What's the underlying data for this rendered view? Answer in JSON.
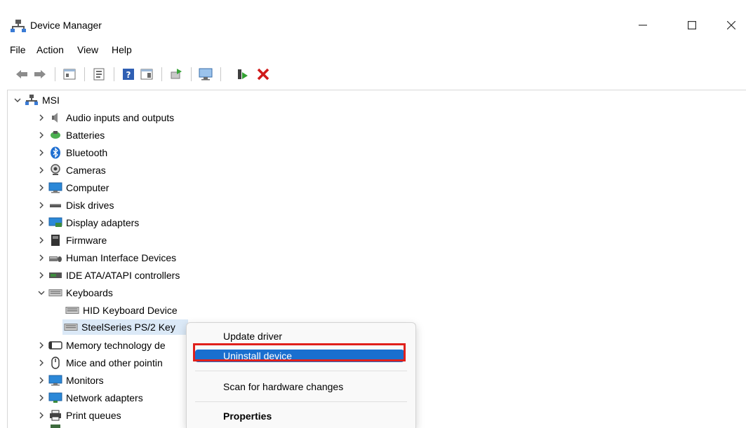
{
  "window": {
    "title": "Device Manager"
  },
  "menu": [
    "File",
    "Action",
    "View",
    "Help"
  ],
  "toolbar": {
    "icons": [
      "back-arrow-icon",
      "forward-arrow-icon",
      "show-hide-console-tree-icon",
      "properties-icon",
      "help-icon",
      "show-action-pane-icon",
      "update-driver-icon",
      "scan-hardware-icon",
      "enable-device-icon",
      "uninstall-device-icon"
    ]
  },
  "tree": {
    "root": "MSI",
    "categories": [
      "Audio inputs and outputs",
      "Batteries",
      "Bluetooth",
      "Cameras",
      "Computer",
      "Disk drives",
      "Display adapters",
      "Firmware",
      "Human Interface Devices",
      "IDE ATA/ATAPI controllers",
      "Keyboards"
    ],
    "keyboards": [
      "HID Keyboard Device",
      "SteelSeries PS/2 Key"
    ],
    "after": [
      "Memory technology de",
      "Mice and other pointin",
      "Monitors",
      "Network adapters",
      "Print queues"
    ]
  },
  "context_menu": {
    "update": "Update driver",
    "uninstall": "Uninstall device",
    "scan": "Scan for hardware changes",
    "properties": "Properties"
  },
  "colors": {
    "highlight": "#1a6fcf",
    "annotation": "#e0201c",
    "uninstall_x": "#d01a1a"
  }
}
